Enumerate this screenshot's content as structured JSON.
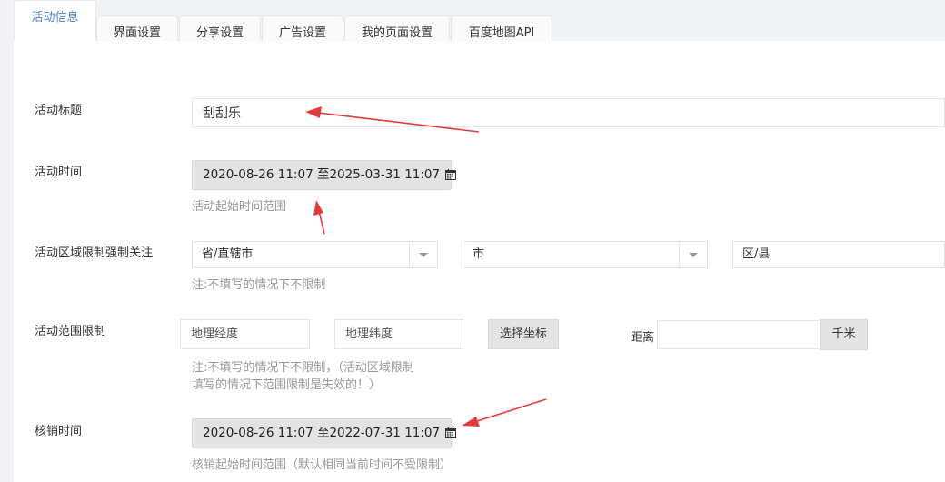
{
  "tabs": [
    {
      "label": "活动信息",
      "active": true
    },
    {
      "label": "界面设置"
    },
    {
      "label": "分享设置"
    },
    {
      "label": "广告设置"
    },
    {
      "label": "我的页面设置"
    },
    {
      "label": "百度地图API"
    }
  ],
  "form": {
    "title": {
      "label": "活动标题",
      "value": "刮刮乐"
    },
    "time": {
      "label": "活动时间",
      "range": "2020-08-26 11:07 至2025-03-31 11:07",
      "help": "活动起始时间范围"
    },
    "region": {
      "label": "活动区域限制强制关注",
      "province": "省/直辖市",
      "city": "市",
      "district": "区/县",
      "help": "注:不填写的情况下不限制"
    },
    "range": {
      "label": "活动范围限制",
      "lng_placeholder": "地理经度",
      "lat_placeholder": "地理纬度",
      "pick_button": "选择坐标",
      "distance_label": "距离",
      "unit": "千米",
      "help_line1": "注:不填写的情况下不限制，（活动区域限制",
      "help_line2": "填写的情况下范围限制是失效的！）"
    },
    "verify": {
      "label": "核销时间",
      "range": "2020-08-26 11:07 至2022-07-31 11:07",
      "help": "核销起始时间范围（默认相同当前时间不受限制）"
    }
  },
  "colors": {
    "accent": "#4a7fc9",
    "arrow": "#e33b3b"
  }
}
